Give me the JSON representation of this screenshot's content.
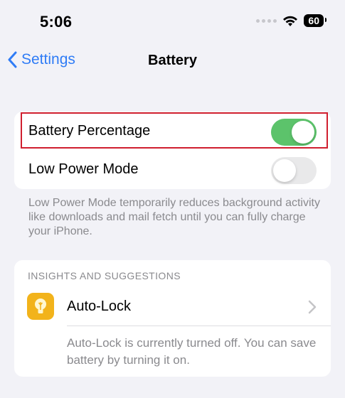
{
  "status_bar": {
    "time": "5:06",
    "battery_level": "60"
  },
  "nav": {
    "back_label": "Settings",
    "title": "Battery"
  },
  "settings_group": {
    "rows": [
      {
        "label": "Battery Percentage",
        "toggle_on": true
      },
      {
        "label": "Low Power Mode",
        "toggle_on": false
      }
    ],
    "footnote": "Low Power Mode temporarily reduces background activity like downloads and mail fetch until you can fully charge your iPhone."
  },
  "insights": {
    "header": "INSIGHTS AND SUGGESTIONS",
    "item_label": "Auto-Lock",
    "item_description": "Auto-Lock is currently turned off. You can save battery by turning it on."
  },
  "colors": {
    "accent": "#2f7cf6",
    "toggle_on": "#5cc36b",
    "highlight_border": "#d01f2f",
    "icon_background": "#f2b31b"
  }
}
